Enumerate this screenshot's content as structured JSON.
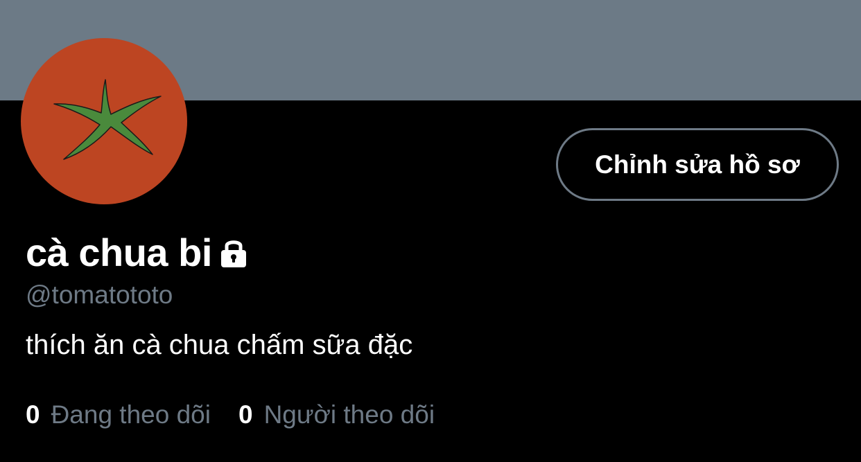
{
  "colors": {
    "banner": "#6c7a86",
    "background": "#000000",
    "avatar_bg": "#bd4522",
    "tomato_leaf": "#4a8a3c",
    "secondary_text": "#6e7a86",
    "button_border": "#6e7a86"
  },
  "profile": {
    "display_name": "cà chua bi",
    "locked_icon": "lock-icon",
    "handle": "@tomatototo",
    "bio": "thích ăn cà chua chấm sữa đặc",
    "edit_button_label": "Chỉnh sửa hồ sơ",
    "avatar_icon": "tomato-stem-icon"
  },
  "stats": {
    "following": {
      "count": "0",
      "label": "Đang theo dõi"
    },
    "followers": {
      "count": "0",
      "label": "Người theo dõi"
    }
  }
}
